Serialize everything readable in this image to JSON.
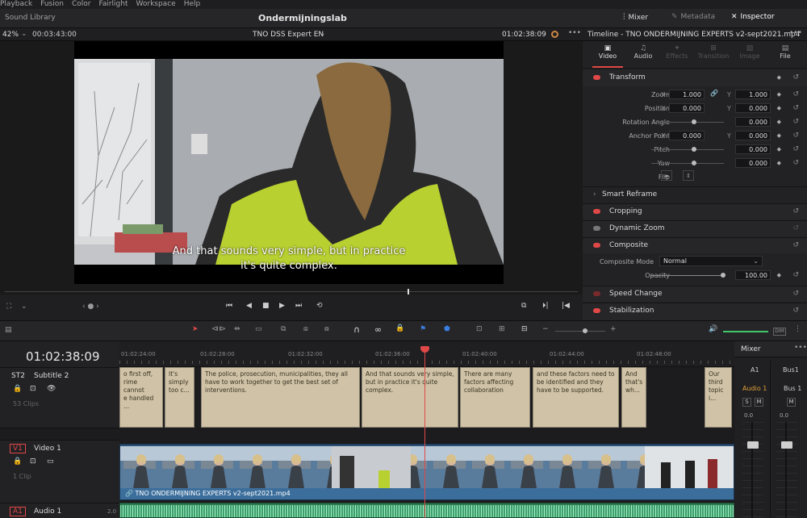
{
  "menu": [
    "Playback",
    "Fusion",
    "Color",
    "Fairlight",
    "Workspace",
    "Help"
  ],
  "header": {
    "left": "Sound Library",
    "title": "Ondermijningslab",
    "mixer": "Mixer",
    "metadata": "Metadata",
    "inspector": "Inspector"
  },
  "viewer": {
    "zoom": "42%",
    "source_tc": "00:03:43:00",
    "clip_name": "TNO DSS Expert EN",
    "record_tc": "01:02:38:09",
    "subtitle_line1": "And that sounds very simple, but in practice",
    "subtitle_line2": "it's quite complex."
  },
  "inspector": {
    "title": "Timeline - TNO ONDERMIJNING EXPERTS v2-sept2021.mp4",
    "tabs": [
      "Video",
      "Audio",
      "Effects",
      "Transition",
      "Image",
      "File"
    ],
    "transform": "Transform",
    "zoom": {
      "label": "Zoom",
      "x": "1.000",
      "y": "1.000"
    },
    "position": {
      "label": "Position",
      "x": "0.000",
      "y": "0.000"
    },
    "rotation": {
      "label": "Rotation Angle",
      "val": "0.000"
    },
    "anchor": {
      "label": "Anchor Point",
      "x": "0.000",
      "y": "0.000"
    },
    "pitch": {
      "label": "Pitch",
      "val": "0.000"
    },
    "yaw": {
      "label": "Yaw",
      "val": "0.000"
    },
    "flip": "Flip",
    "smart_reframe": "Smart Reframe",
    "cropping": "Cropping",
    "dynamic_zoom": "Dynamic Zoom",
    "composite": "Composite",
    "composite_mode": {
      "label": "Composite Mode",
      "val": "Normal"
    },
    "opacity": {
      "label": "Opacity",
      "val": "100.00"
    },
    "speed_change": "Speed Change",
    "stabilization": "Stabilization"
  },
  "timeline": {
    "timecode": "01:02:38:09",
    "ticks": [
      "01:02:24:00",
      "01:02:28:00",
      "01:02:32:00",
      "01:02:36:00",
      "01:02:40:00",
      "01:02:44:00",
      "01:02:48:00"
    ],
    "st2": {
      "id": "ST2",
      "name": "Subtitle 2",
      "clips": "53 Clips"
    },
    "v1": {
      "id": "V1",
      "name": "Video 1",
      "clips": "1 Clip"
    },
    "a1": {
      "id": "A1",
      "name": "Audio 1",
      "level": "2.0"
    },
    "video_clip": "TNO ONDERMIJNING EXPERTS v2-sept2021.mp4",
    "subclips": [
      "o first off, \nrime cannot \ne handled ...",
      "It's \nsimply \ntoo c...",
      "The police, prosecution, municipalities, they all have to work together to get the best set of interventions.",
      "And that sounds very simple, but in practice it's quite complex.",
      "There are many factors affecting collaboration",
      "and these factors need to be identified and they have to be supported.",
      "And that's wh...",
      "Our third topic i..."
    ]
  },
  "mixer": {
    "title": "Mixer",
    "a1": "A1",
    "bus1": "Bus1",
    "audio1": "Audio 1",
    "bus1b": "Bus 1",
    "s": "S",
    "m": "M",
    "v1": "0.0",
    "v2": "0.0"
  },
  "colors": {
    "accent_red": "#e04848",
    "subtitle_clip": "#cfc2a6",
    "video_track": "#2f5f8f",
    "audio_track": "#3e9e6e"
  }
}
